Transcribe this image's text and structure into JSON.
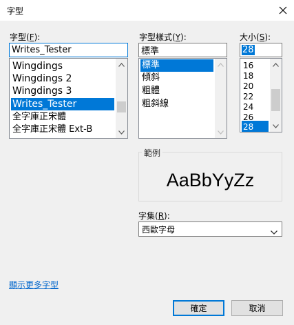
{
  "dialog": {
    "title": "字型"
  },
  "font": {
    "label_pre": "字型(",
    "label_key": "F",
    "label_post": "):",
    "value": "Writes_Tester",
    "items": [
      "Wingdings",
      "Wingdings 2",
      "Wingdings 3",
      "Writes_Tester",
      "全字庫正宋體",
      "全字庫正宋體 Ext-B"
    ],
    "selected_index": 3
  },
  "style": {
    "label_pre": "字型樣式(",
    "label_key": "Y",
    "label_post": "):",
    "value": "標準",
    "items": [
      "標準",
      "傾斜",
      "粗體",
      "粗斜線"
    ],
    "selected_index": 0
  },
  "size": {
    "label_pre": "大小(",
    "label_key": "S",
    "label_post": "):",
    "value": "28",
    "items": [
      "16",
      "18",
      "20",
      "22",
      "24",
      "26",
      "28"
    ],
    "selected_index": 6
  },
  "sample": {
    "label": "範例",
    "text": "AaBbYyZz"
  },
  "script": {
    "label_pre": "字集(",
    "label_key": "R",
    "label_post": "):",
    "value": "西歐字母"
  },
  "more_fonts_link": "顯示更多字型",
  "buttons": {
    "ok": "確定",
    "cancel": "取消"
  },
  "colors": {
    "accent": "#0078d7",
    "link": "#0066cc"
  }
}
